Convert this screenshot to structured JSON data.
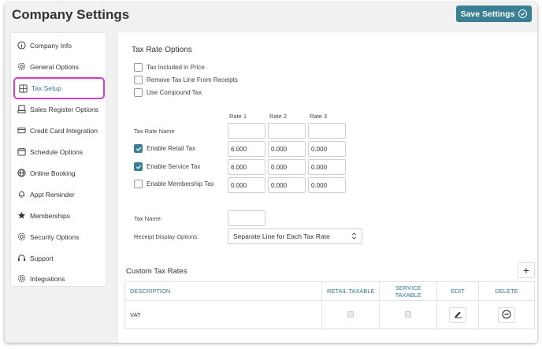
{
  "header": {
    "title": "Company Settings",
    "save_label": "Save Settings"
  },
  "sidebar": {
    "items": [
      {
        "label": "Company Info",
        "icon": "info-icon"
      },
      {
        "label": "General Options",
        "icon": "gear-icon"
      },
      {
        "label": "Tax Setup",
        "icon": "calculator-icon",
        "active": true
      },
      {
        "label": "Sales Register Options",
        "icon": "register-icon"
      },
      {
        "label": "Credit Card Integration",
        "icon": "credit-card-icon"
      },
      {
        "label": "Schedule Options",
        "icon": "calendar-icon"
      },
      {
        "label": "Online Booking",
        "icon": "globe-icon"
      },
      {
        "label": "Appt Reminder",
        "icon": "bell-icon"
      },
      {
        "label": "Memberships",
        "icon": "star-icon"
      },
      {
        "label": "Security Options",
        "icon": "gear-icon"
      },
      {
        "label": "Support",
        "icon": "headset-icon"
      },
      {
        "label": "Integrations",
        "icon": "gear-icon"
      }
    ]
  },
  "tax": {
    "section_title": "Tax Rate Options",
    "options": [
      {
        "label": "Tax Included in Price",
        "checked": false
      },
      {
        "label": "Remove Tax Line From Receipts",
        "checked": false
      },
      {
        "label": "Use Compound Tax",
        "checked": false
      }
    ],
    "rate_headers": [
      "Rate 1",
      "Rate 2",
      "Rate 3"
    ],
    "tax_rate_name_label": "Tax Rate Name",
    "tax_rate_names": [
      "",
      "",
      ""
    ],
    "rows": [
      {
        "label": "Enable Retail Tax",
        "checked": true,
        "values": [
          "6.000",
          "0.000",
          "0.000"
        ]
      },
      {
        "label": "Enable Service Tax",
        "checked": true,
        "values": [
          "6.000",
          "0.000",
          "0.000"
        ]
      },
      {
        "label": "Enable Membership Tax",
        "checked": false,
        "values": [
          "0.000",
          "0.000",
          "0.000"
        ]
      }
    ],
    "tax_name_label": "Tax Name:",
    "tax_name_value": "",
    "receipt_display_label": "Receipt Display Options:",
    "receipt_display_value": "Separate Line for Each Tax Rate"
  },
  "custom": {
    "title": "Custom Tax Rates",
    "add_label": "+",
    "columns": [
      "DESCRIPTION",
      "RETAIL TAXABLE",
      "SERVICE TAXABLE",
      "EDIT",
      "DELETE"
    ],
    "rows": [
      {
        "description": "VAT",
        "retail_taxable": true,
        "service_taxable": true
      }
    ]
  },
  "colors": {
    "accent": "#3a7f93",
    "highlight": "#d63bd0"
  }
}
